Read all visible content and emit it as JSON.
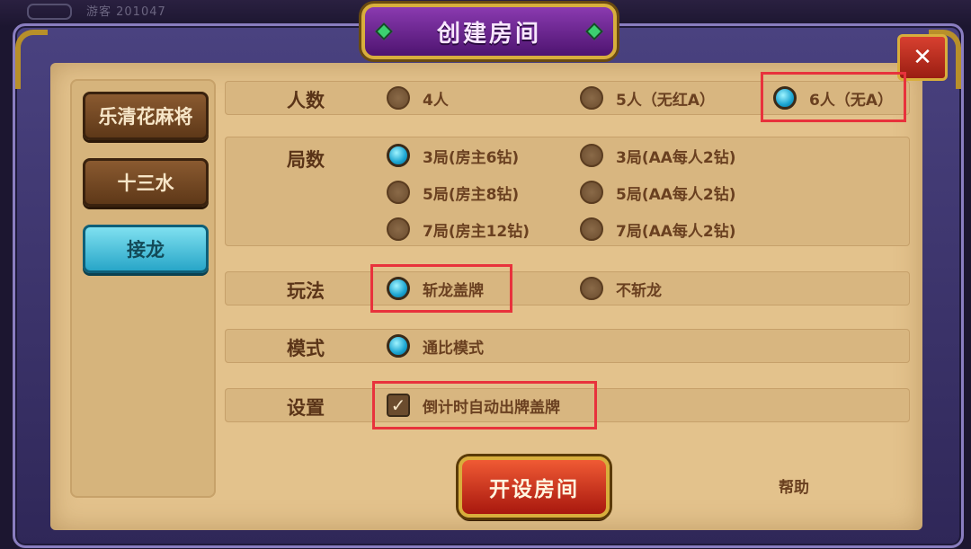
{
  "top_bar": {
    "player_id": "游客 201047"
  },
  "dialog": {
    "title": "创建房间",
    "close_icon": "close-icon"
  },
  "tabs": [
    {
      "label": "乐清花麻将",
      "active": false
    },
    {
      "label": "十三水",
      "active": false
    },
    {
      "label": "接龙",
      "active": true
    }
  ],
  "rows": {
    "players": {
      "label": "人数",
      "options": [
        {
          "label": "4人",
          "selected": false
        },
        {
          "label": "5人（无红A）",
          "selected": false
        },
        {
          "label": "6人（无A）",
          "selected": true
        }
      ]
    },
    "rounds": {
      "label": "局数",
      "options": [
        {
          "label": "3局(房主6钻)",
          "selected": true
        },
        {
          "label": "3局(AA每人2钻)",
          "selected": false
        },
        {
          "label": "5局(房主8钻)",
          "selected": false
        },
        {
          "label": "5局(AA每人2钻)",
          "selected": false
        },
        {
          "label": "7局(房主12钻)",
          "selected": false
        },
        {
          "label": "7局(AA每人2钻)",
          "selected": false
        }
      ]
    },
    "gameplay": {
      "label": "玩法",
      "options": [
        {
          "label": "斩龙盖牌",
          "selected": true
        },
        {
          "label": "不斩龙",
          "selected": false
        }
      ]
    },
    "mode": {
      "label": "模式",
      "options": [
        {
          "label": "通比模式",
          "selected": true
        }
      ]
    },
    "settings": {
      "label": "设置",
      "checkbox": {
        "label": "倒计时自动出牌盖牌",
        "checked": true
      }
    }
  },
  "actions": {
    "create_label": "开设房间",
    "help_label": "帮助"
  },
  "colors": {
    "accent": "#1aa3d0",
    "highlight": "#e8323c",
    "gold": "#d8ae3c"
  }
}
